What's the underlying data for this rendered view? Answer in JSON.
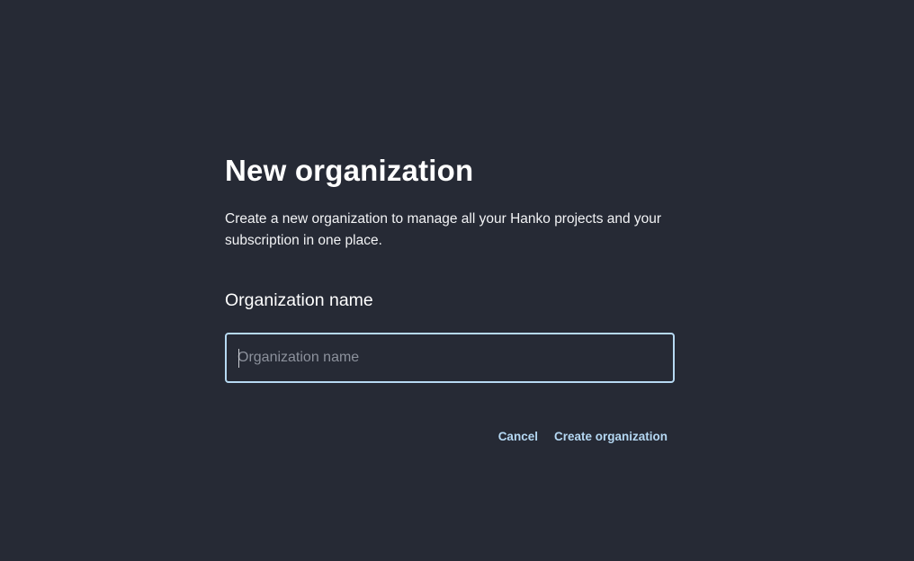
{
  "dialog": {
    "title": "New organization",
    "description": "Create a new organization to manage all your Hanko projects and your subscription in one place.",
    "field_label": "Organization name",
    "input": {
      "value": "",
      "placeholder": "Organization name"
    },
    "cancel_label": "Cancel",
    "create_label": "Create organization"
  },
  "colors": {
    "background": "#262a35",
    "accent": "#b5d8f3",
    "text": "#ffffff"
  }
}
